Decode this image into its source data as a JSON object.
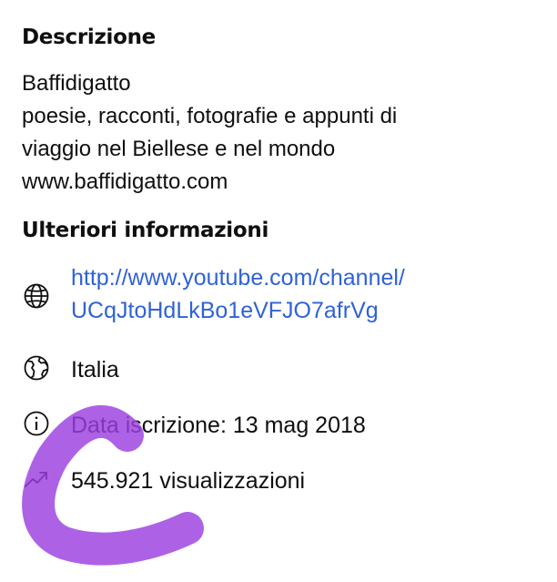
{
  "description": {
    "heading": "Descrizione",
    "lines": [
      "Baffidigatto",
      "poesie, racconti, fotografie e appunti di",
      "viaggio nel Biellese e nel mondo",
      "www.baffidigatto.com"
    ]
  },
  "more_info": {
    "heading": "Ulteriori informazioni",
    "link": {
      "icon": "globe-icon",
      "line1": "http://www.youtube.com/channel/",
      "line2": "UCqJtoHdLkBo1eVFJO7afrVg"
    },
    "country": {
      "icon": "earth-icon",
      "text": "Italia"
    },
    "joined": {
      "icon": "info-icon",
      "text": "Data iscrizione: 13 mag 2018"
    },
    "views": {
      "icon": "trending-icon",
      "text": "545.921 visualizzazioni"
    }
  },
  "colors": {
    "link": "#2f62d7",
    "text": "#0f0f0f",
    "scribble": "#9b3fe0"
  }
}
